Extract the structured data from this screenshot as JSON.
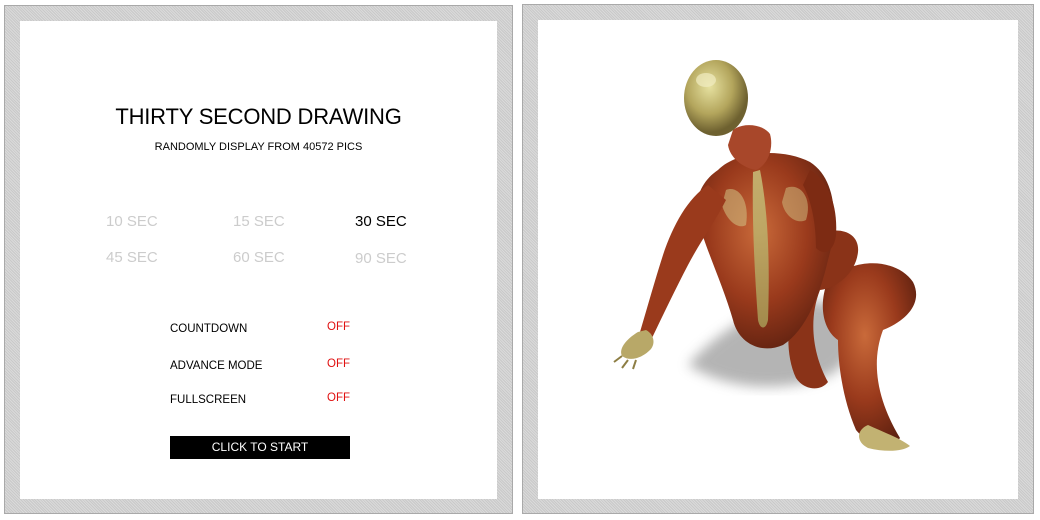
{
  "app": {
    "title": "THIRTY SECOND DRAWING",
    "subtitle": "RANDOMLY DISPLAY FROM 40572 PICS"
  },
  "time_options": [
    {
      "label": "10 SEC",
      "selected": false
    },
    {
      "label": "15 SEC",
      "selected": false
    },
    {
      "label": "30 SEC",
      "selected": true
    },
    {
      "label": "45 SEC",
      "selected": false
    },
    {
      "label": "60 SEC",
      "selected": false
    },
    {
      "label": "90 SEC",
      "selected": false
    }
  ],
  "settings": [
    {
      "label": "COUNTDOWN",
      "value": "OFF"
    },
    {
      "label": "ADVANCE MODE",
      "value": "OFF"
    },
    {
      "label": "FULLSCREEN",
      "value": "OFF"
    }
  ],
  "start_button": {
    "label": "CLICK TO START"
  },
  "colors": {
    "off_value": "#e01010",
    "unselected_option": "#cccccc",
    "selected_option": "#000000",
    "button_background": "#000000"
  },
  "preview": {
    "image_subject": "anatomical muscle figure seated, viewed from behind"
  }
}
